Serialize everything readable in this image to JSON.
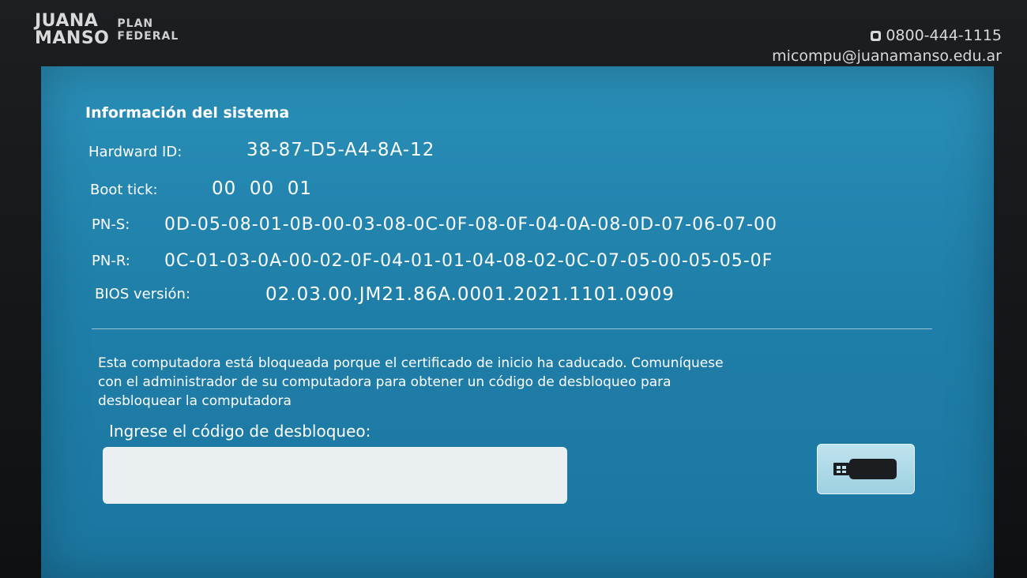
{
  "brand": {
    "line1": "JUANA",
    "line2": "MANSO",
    "plan1": "PLAN",
    "plan2": "FEDERAL"
  },
  "contact": {
    "phone": "0800-444-1115",
    "email": "micompu@juanamanso.edu.ar",
    "phone_icon": "phone-icon"
  },
  "system_info": {
    "title": "Información del sistema",
    "hardware_id_label": "Hardward ID:",
    "hardware_id_value": "38-87-D5-A4-8A-12",
    "boot_tick_label": "Boot tick:",
    "boot_tick_value": "00  00  01",
    "pn_s_label": "PN-S:",
    "pn_s_value": "0D-05-08-01-0B-00-03-08-0C-0F-08-0F-04-0A-08-0D-07-06-07-00",
    "pn_r_label": "PN-R:",
    "pn_r_value": "0C-01-03-0A-00-02-0F-04-01-01-04-08-02-0C-07-05-00-05-05-0F",
    "bios_label": "BIOS versión:",
    "bios_value": "02.03.00.JM21.86A.0001.2021.1101.0909"
  },
  "lock": {
    "message_line1": "Esta computadora está bloqueada porque el certificado de inicio ha caducado. Comuníquese",
    "message_line2": "con el administrador de su computadora para obtener un código de desbloqueo para",
    "message_line3": "desbloquear la computadora",
    "prompt": "Ingrese el código de desbloqueo:",
    "input_value": "",
    "usb_icon": "usb-drive-icon"
  },
  "colors": {
    "screen_bg": "#2185b0",
    "bezel": "#15181b",
    "text": "#ffffff"
  }
}
